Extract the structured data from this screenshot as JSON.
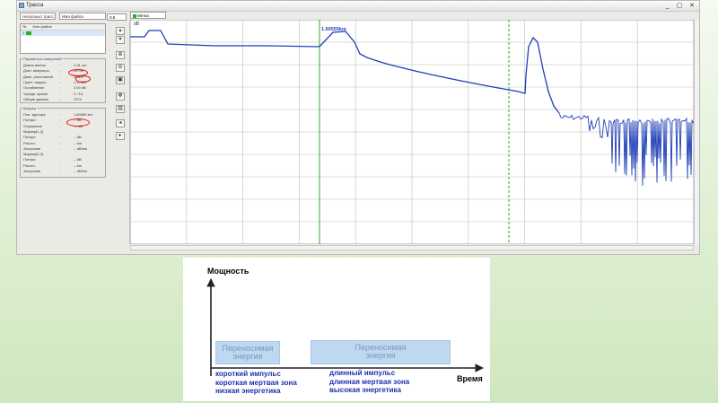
{
  "window": {
    "title": "Трасса",
    "controls": "_ ▢ ✕",
    "combo_left": "Несколько трасс",
    "combo_right": "Имя файла",
    "combo_tools": "0.5",
    "trace_tab": "Метка",
    "list": {
      "col1": "№",
      "col2": "Имя файла",
      "row_no": "1"
    }
  },
  "params": {
    "title": "Параметры измерений",
    "rows": [
      {
        "k": "Длина волны",
        "v": "1.31 um"
      },
      {
        "k": "Длит. импульса",
        "v": "25 nm"
      },
      {
        "k": "Диап. расстояний",
        "v": "10 km"
      },
      {
        "k": "Групп. индекс",
        "v": "1.47187"
      },
      {
        "k": "Ослабление",
        "v": "3.00 dB"
      },
      {
        "k": "Усредн. время",
        "v": "2 / 16"
      },
      {
        "k": "Общие данные",
        "v": "1974"
      }
    ]
  },
  "markers": {
    "title": "Маркер",
    "rows": [
      {
        "k": "Пол. курсора",
        "v": "1.60555 km"
      },
      {
        "k": "Потери",
        "v": "-- dB"
      },
      {
        "k": "Отражение",
        "v": "--- dB"
      },
      {
        "k": "Маркер[1-2]",
        "v": ""
      },
      {
        "k": "Потери",
        "v": "-- dB"
      },
      {
        "k": "Рассто.",
        "v": "-- km"
      },
      {
        "k": "Затухание",
        "v": "-- dB/km"
      },
      {
        "k": "Маркер[3-4]",
        "v": ""
      },
      {
        "k": "Потери",
        "v": "-- dB"
      },
      {
        "k": "Рассто.",
        "v": "-- km"
      },
      {
        "k": "Затухание",
        "v": "-- dB/km"
      }
    ]
  },
  "plot": {
    "cursor_label": "1.60555km",
    "y_unit": "dB",
    "trace_color": "#1f3fb8",
    "cursor_color": "#22b022",
    "grid_color": "#bdbdbd"
  },
  "diagram": {
    "y_axis": "Мощность",
    "x_axis": "Время",
    "box_short": "Переносимая энергия",
    "box_long": "Переносимая энергия",
    "short_lines": [
      "короткий импульс",
      "короткая мертвая зона",
      "низкая энергетика"
    ],
    "long_lines": [
      "длинный импульс",
      "длинная мертвая зона",
      "высокая энергетика"
    ],
    "box_color": "#bed8f2",
    "caption_color": "#1f2fae"
  }
}
